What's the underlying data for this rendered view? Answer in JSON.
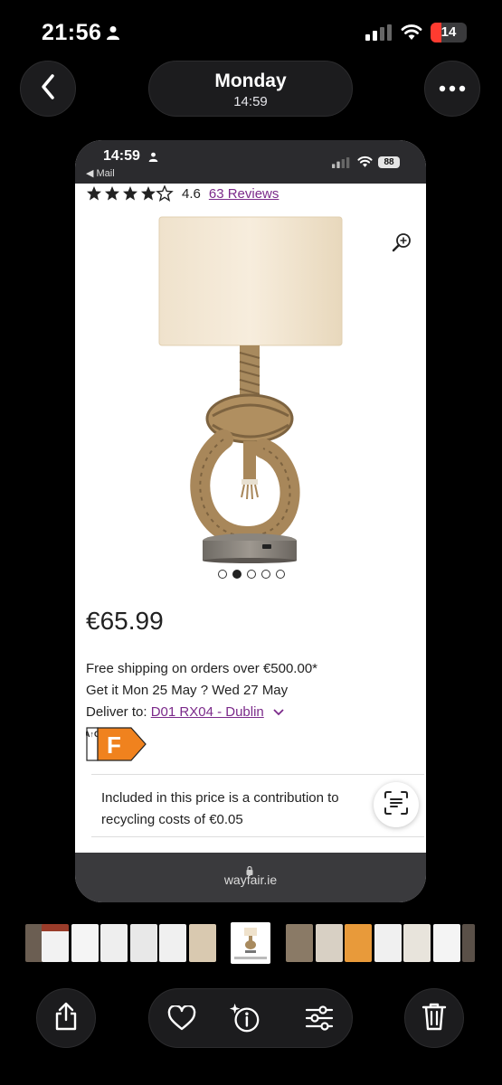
{
  "status_bar": {
    "time": "21:56",
    "battery_level": "14",
    "icons": [
      "person-icon",
      "signal-icon",
      "wifi-icon",
      "battery-icon"
    ],
    "battery_color": "#ff3b30"
  },
  "header": {
    "day": "Monday",
    "time": "14:59",
    "icons": [
      "chevron-left-icon",
      "ellipsis-icon"
    ]
  },
  "screenshot": {
    "status_bar": {
      "time": "14:59",
      "back_app": "◀ Mail",
      "battery_level": "88"
    },
    "product": {
      "rating": "4.6",
      "stars_filled": 4.5,
      "reviews_link": "63 Reviews",
      "image_dots": 5,
      "active_image_dot": 2,
      "price": "€65.99",
      "shipping_note": "Free shipping on orders over €500.00*",
      "delivery_estimate": "Get it Mon 25 May ? Wed 27 May",
      "deliver_to_label": "Deliver to: ",
      "deliver_to_location": "D01 RX04 - Dublin",
      "energy_scale": "A↑G",
      "energy_class": "F",
      "recycling_note": "Included in this price is a contribution to recycling costs of €0.05"
    },
    "url_bar": {
      "domain": "wayfair.ie"
    },
    "colors": {
      "link": "#7b2a8a",
      "energy_orange": "#f0821e"
    }
  },
  "toolbar": {
    "icons": [
      "share-icon",
      "heart-icon",
      "info-sparkle-icon",
      "sliders-icon",
      "trash-icon"
    ]
  }
}
